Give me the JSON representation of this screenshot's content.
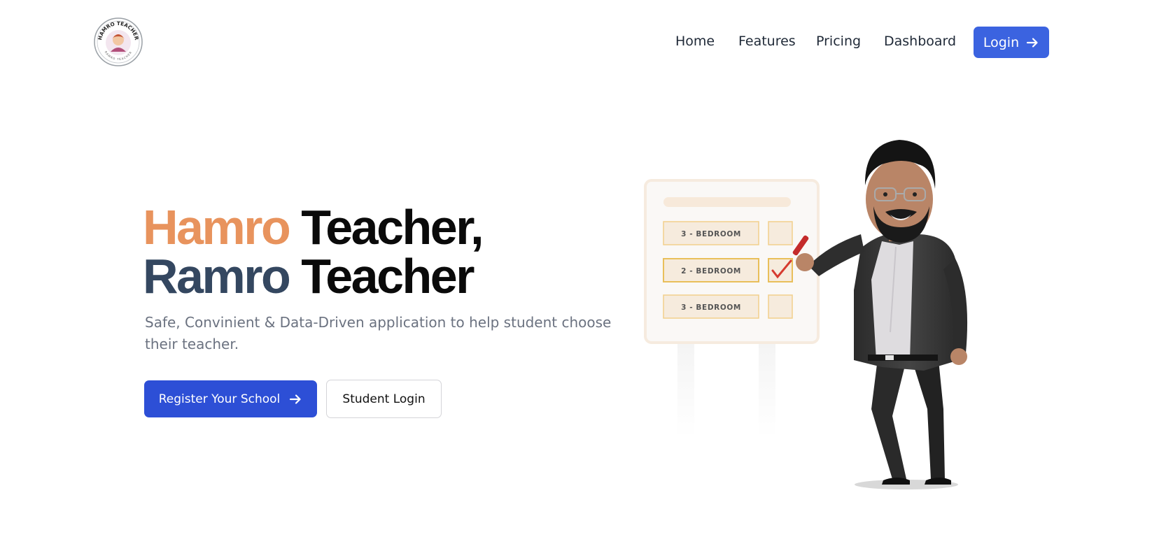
{
  "brand": {
    "logo_icon": "teacher-badge-icon",
    "logo_text_top": "HAMRO TEACHER",
    "logo_text_bottom": "RAMRO TEACHER"
  },
  "nav": {
    "items": [
      {
        "label": "Home"
      },
      {
        "label": "Features"
      },
      {
        "label": "Pricing"
      },
      {
        "label": "Dashboard"
      }
    ],
    "login_label": "Login"
  },
  "hero": {
    "title_word1": "Hamro",
    "title_word2": "Teacher,",
    "title_word3": "Ramro",
    "title_word4": "Teacher",
    "subtitle": "Safe, Convinient & Data-Driven application to help student choose their teacher.",
    "primary_cta": "Register Your School",
    "secondary_cta": "Student Login"
  },
  "illustration": {
    "board_rows": [
      {
        "label": "3 - BEDROOM",
        "checked": false
      },
      {
        "label": "2 - BEDROOM",
        "checked": true
      },
      {
        "label": "3 - BEDROOM",
        "checked": false
      }
    ]
  },
  "colors": {
    "accent_blue": "#3b63e0",
    "cta_blue": "#2d4fd6",
    "title_orange": "#e8935d",
    "title_slate": "#344760"
  }
}
